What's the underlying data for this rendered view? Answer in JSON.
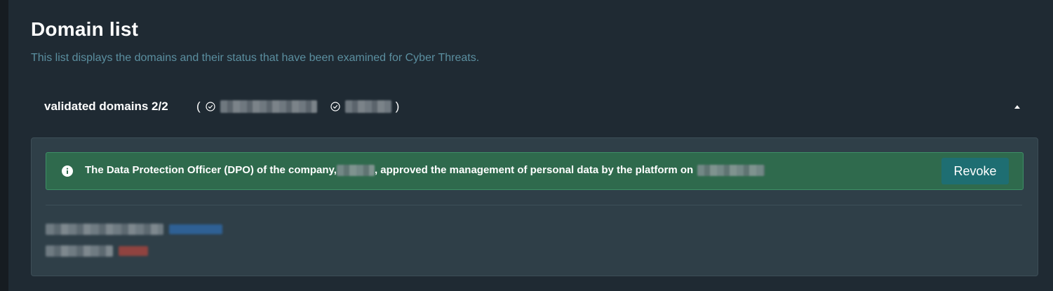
{
  "page": {
    "title": "Domain list",
    "subtitle": "This list displays the domains and their status that have been examined for Cyber Threats."
  },
  "section": {
    "title": "validated domains 2/2",
    "open_paren": "(",
    "close_paren": ")",
    "status_icon": "check-circle-icon",
    "toggle_icon": "caret-up-icon"
  },
  "alert": {
    "icon": "info-icon",
    "text_part1": "The Data Protection Officer (DPO) of the company, ",
    "text_part2": ", approved the management of personal data by the platform on",
    "revoke_label": "Revoke"
  },
  "colors": {
    "background": "#1f2a33",
    "subtitle": "#5b8fa0",
    "content_box": "#2f3f48",
    "alert_bg": "#2f6a4d",
    "revoke_bg": "#1e6e72",
    "status_blue": "#2f6fb5",
    "status_red": "#b9453d"
  }
}
